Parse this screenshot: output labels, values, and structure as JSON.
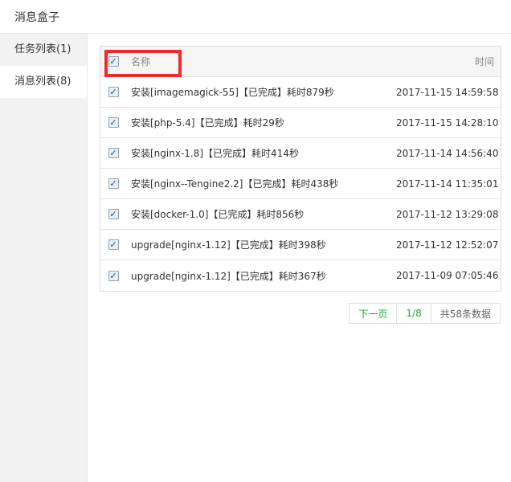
{
  "window": {
    "title": "消息盒子"
  },
  "sidebar": {
    "items": [
      {
        "label": "任务列表(1)",
        "active": false
      },
      {
        "label": "消息列表(8)",
        "active": true
      }
    ]
  },
  "table": {
    "header": {
      "name": "名称",
      "time": "时间",
      "checked": true
    },
    "rows": [
      {
        "name": "安装[imagemagick-55]【已完成】耗时879秒",
        "time": "2017-11-15 14:59:58",
        "checked": true
      },
      {
        "name": "安装[php-5.4]【已完成】耗时29秒",
        "time": "2017-11-15 14:28:10",
        "checked": true
      },
      {
        "name": "安装[nginx-1.8]【已完成】耗时414秒",
        "time": "2017-11-14 14:56:40",
        "checked": true
      },
      {
        "name": "安装[nginx--Tengine2.2]【已完成】耗时438秒",
        "time": "2017-11-14 11:35:01",
        "checked": true
      },
      {
        "name": "安装[docker-1.0]【已完成】耗时856秒",
        "time": "2017-11-12 13:29:08",
        "checked": true
      },
      {
        "name": "upgrade[nginx-1.12]【已完成】耗时398秒",
        "time": "2017-11-12 12:52:07",
        "checked": true
      },
      {
        "name": "upgrade[nginx-1.12]【已完成】耗时367秒",
        "time": "2017-11-09 07:05:46",
        "checked": true
      }
    ]
  },
  "pager": {
    "next": "下一页",
    "page": "1/8",
    "total": "共58条数据"
  },
  "check_glyph": "✓",
  "colors": {
    "highlight": "#ee2a2a",
    "accent": "#20a53a"
  }
}
